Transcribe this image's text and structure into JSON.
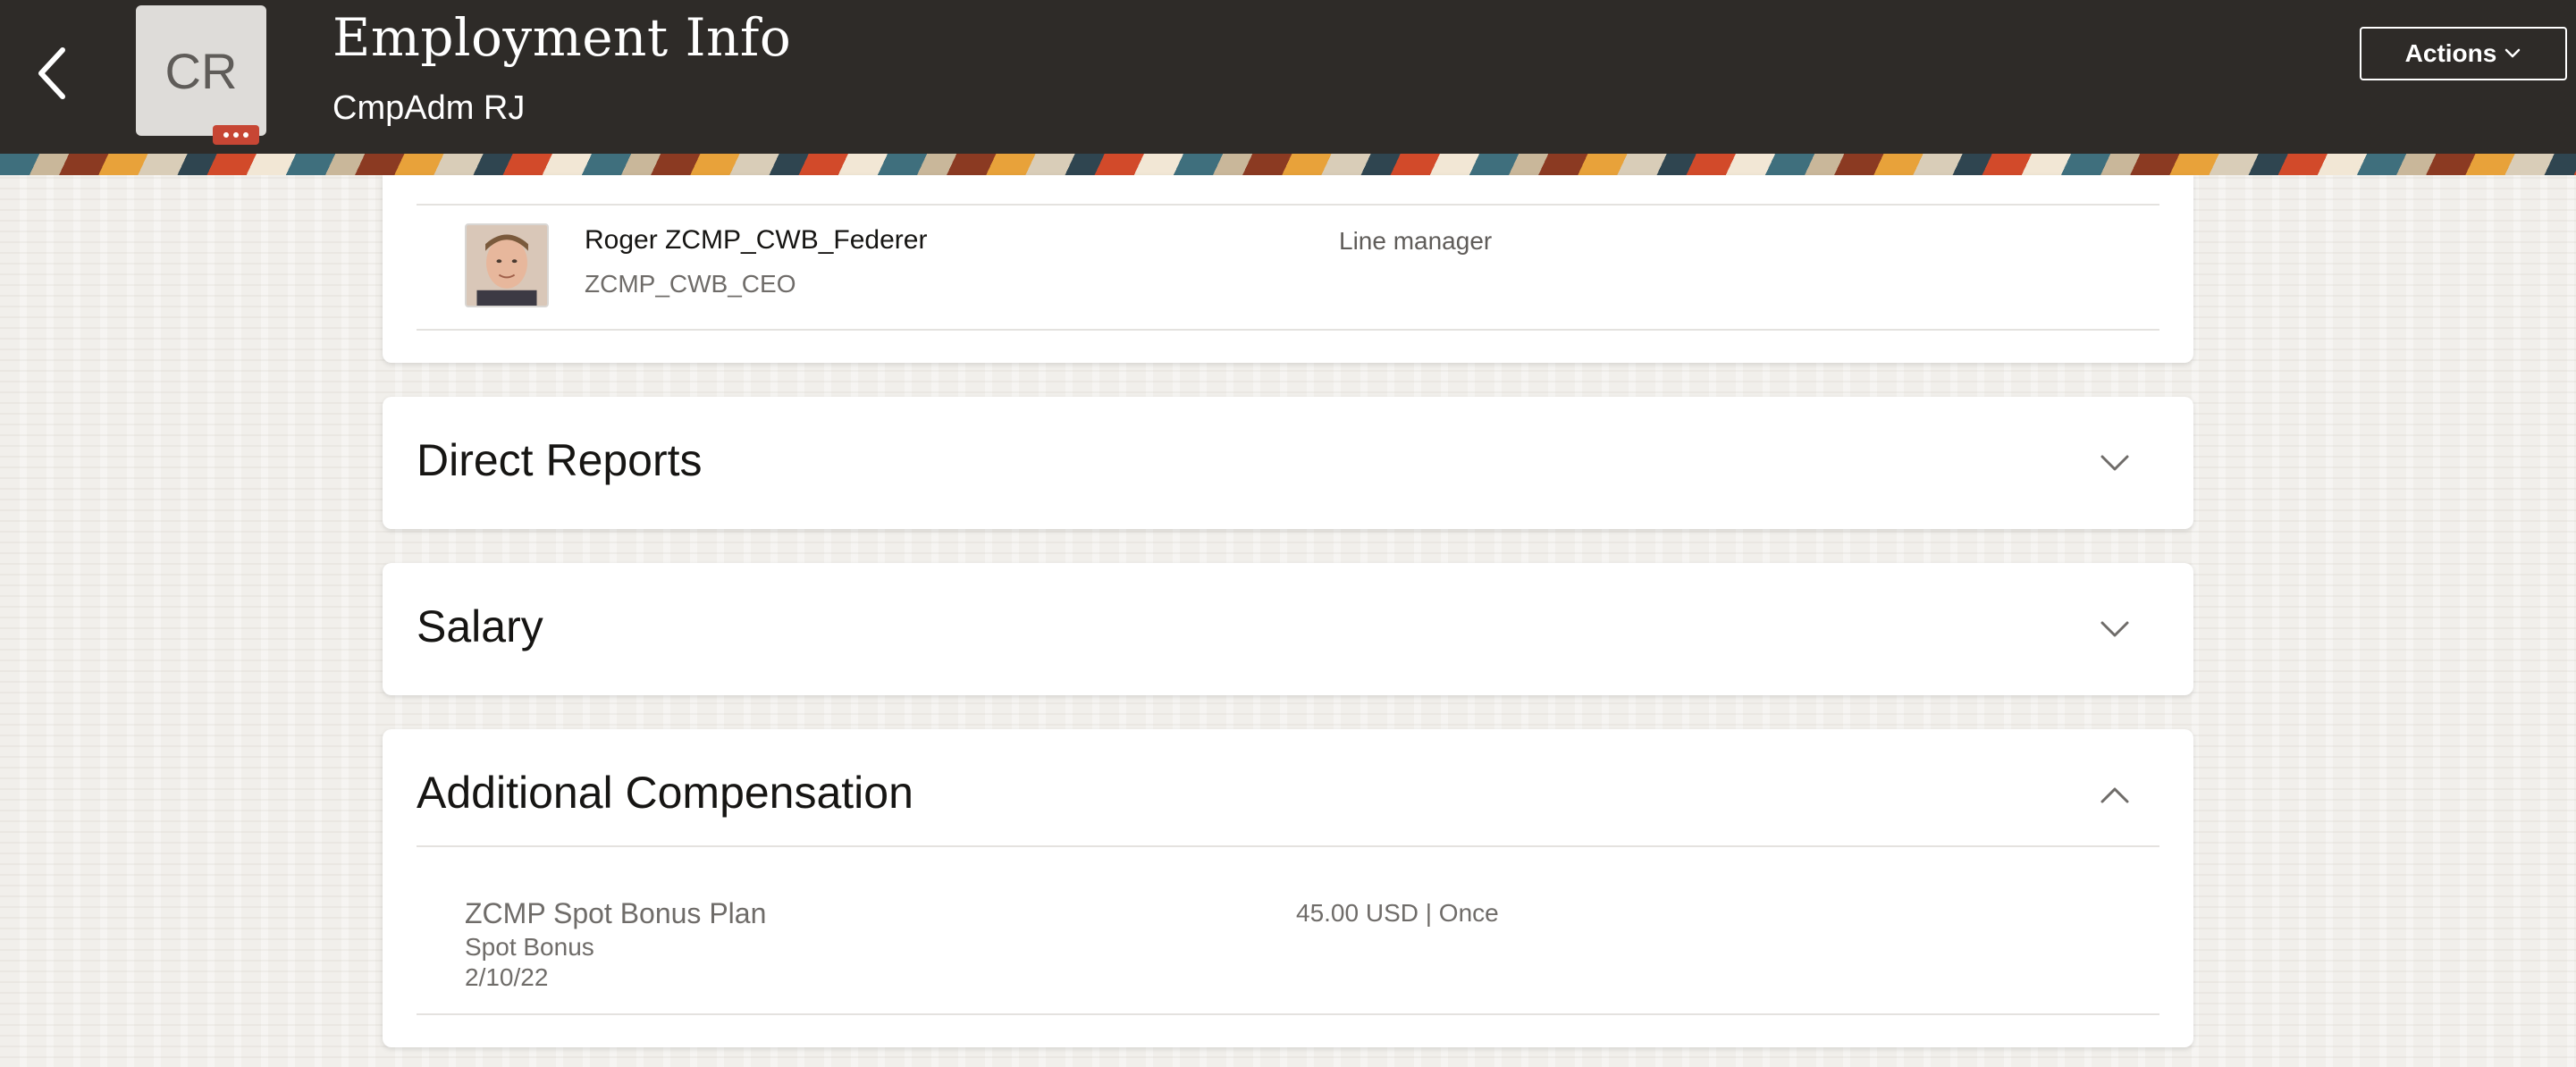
{
  "header": {
    "title": "Employment Info",
    "subtitle": "CmpAdm RJ",
    "avatar_initials": "CR",
    "actions_label": "Actions",
    "background_color": "#2e2b28"
  },
  "manager": {
    "name": "Roger ZCMP_CWB_Federer",
    "title": "ZCMP_CWB_CEO",
    "relationship": "Line manager"
  },
  "sections": {
    "direct_reports": {
      "title": "Direct Reports",
      "expanded": false
    },
    "salary": {
      "title": "Salary",
      "expanded": false
    },
    "additional_compensation": {
      "title": "Additional Compensation",
      "expanded": true,
      "items": [
        {
          "plan": "ZCMP Spot Bonus Plan",
          "type": "Spot Bonus",
          "date": "2/10/22",
          "amount": "45.00 USD | Once"
        }
      ]
    }
  },
  "icons": {
    "back": "chevron-left-icon",
    "more": "ellipsis-icon",
    "actions": "chevron-down-icon",
    "collapsed": "chevron-down-icon",
    "expanded": "chevron-up-icon"
  },
  "colors": {
    "accent": "#c74634",
    "card_background": "#ffffff",
    "page_background": "#f1efeb"
  }
}
